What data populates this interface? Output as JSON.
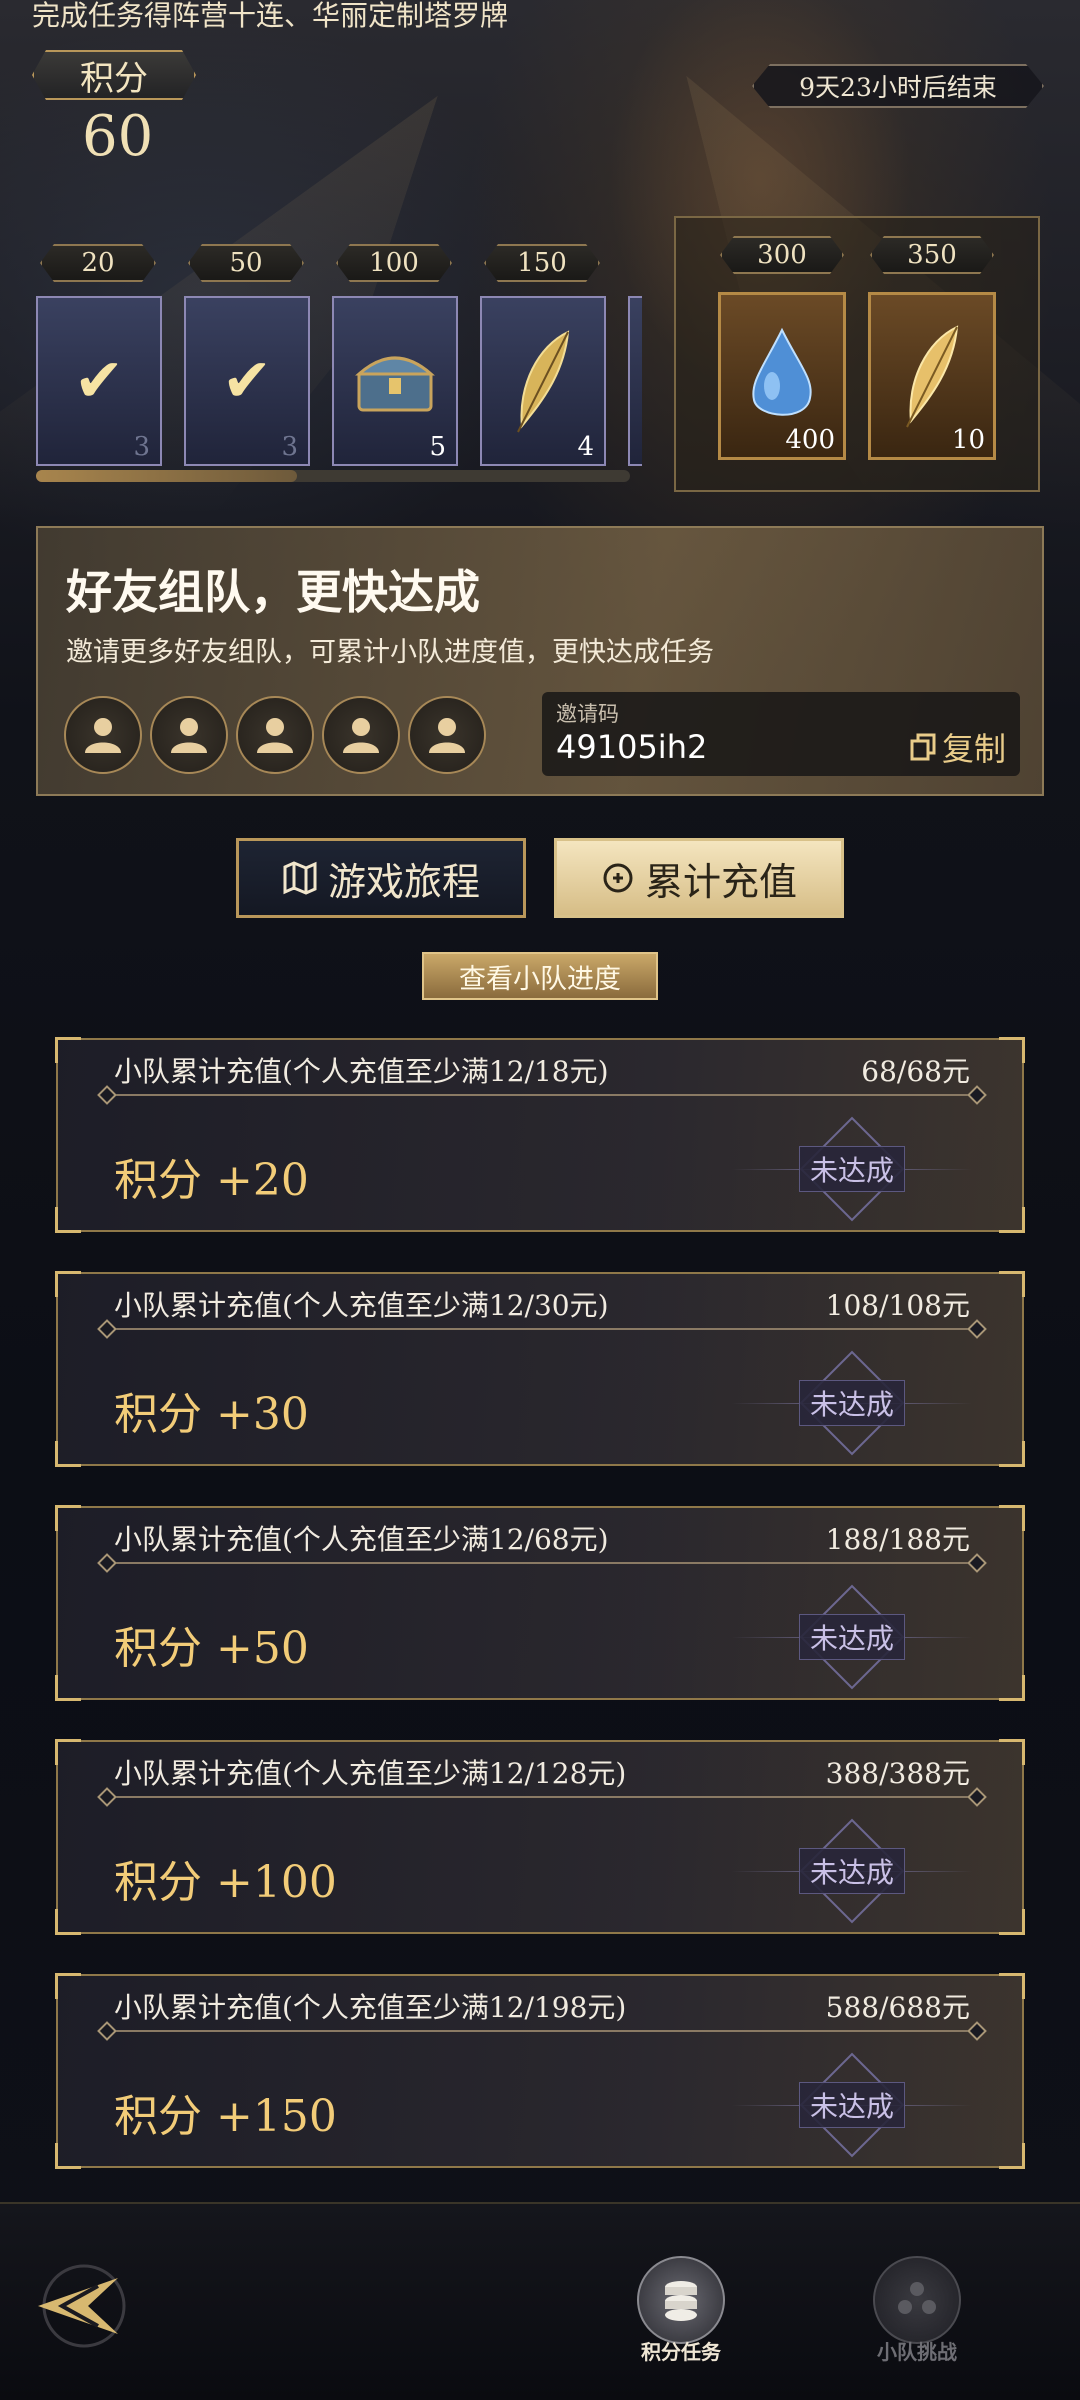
{
  "header": {
    "banner_text": "完成任务得阵营十连、华丽定制塔罗牌",
    "score_label": "积分",
    "score_value": "60",
    "timer_text": "9天23小时后结束"
  },
  "milestones": [
    {
      "points": "20",
      "icon": "claimed-check-icon",
      "qty": "3",
      "claimed": true
    },
    {
      "points": "50",
      "icon": "claimed-check-icon",
      "qty": "3",
      "claimed": true
    },
    {
      "points": "100",
      "icon": "treasure-chest-icon",
      "qty": "5",
      "claimed": false
    },
    {
      "points": "150",
      "icon": "golden-feather-icon",
      "qty": "4",
      "claimed": false
    }
  ],
  "milestone_progress": 0.44,
  "premium_rewards": [
    {
      "points": "300",
      "icon": "blue-crystal-icon",
      "qty": "400"
    },
    {
      "points": "350",
      "icon": "golden-feather-icon",
      "qty": "10"
    }
  ],
  "team": {
    "title": "好友组队，更快达成",
    "description": "邀请更多好友组队，可累计小队进度值，更快达成任务",
    "slots": 5,
    "invite_label": "邀请码",
    "invite_code": "49105ih2",
    "copy_label": "复制"
  },
  "tabs": [
    {
      "label": "游戏旅程",
      "active": false
    },
    {
      "label": "累计充值",
      "active": true
    }
  ],
  "view_progress_label": "查看小队进度",
  "tasks": [
    {
      "title": "小队累计充值(个人充值至少满12/18元)",
      "progress": "68/68元",
      "reward": "积分 +20",
      "status": "未达成"
    },
    {
      "title": "小队累计充值(个人充值至少满12/30元)",
      "progress": "108/108元",
      "reward": "积分 +30",
      "status": "未达成"
    },
    {
      "title": "小队累计充值(个人充值至少满12/68元)",
      "progress": "188/188元",
      "reward": "积分 +50",
      "status": "未达成"
    },
    {
      "title": "小队累计充值(个人充值至少满12/128元)",
      "progress": "388/388元",
      "reward": "积分 +100",
      "status": "未达成"
    },
    {
      "title": "小队累计充值(个人充值至少满12/198元)",
      "progress": "588/688元",
      "reward": "积分 +150",
      "status": "未达成"
    }
  ],
  "bottom_nav": [
    {
      "label": "积分任务",
      "icon": "coin-stack-icon",
      "active": true
    },
    {
      "label": "小队挑战",
      "icon": "team-icon",
      "active": false
    }
  ],
  "colors": {
    "accent_gold": "#d7b870",
    "reward_gold": "#f2cc78",
    "status_purple": "#c9c0e6"
  }
}
